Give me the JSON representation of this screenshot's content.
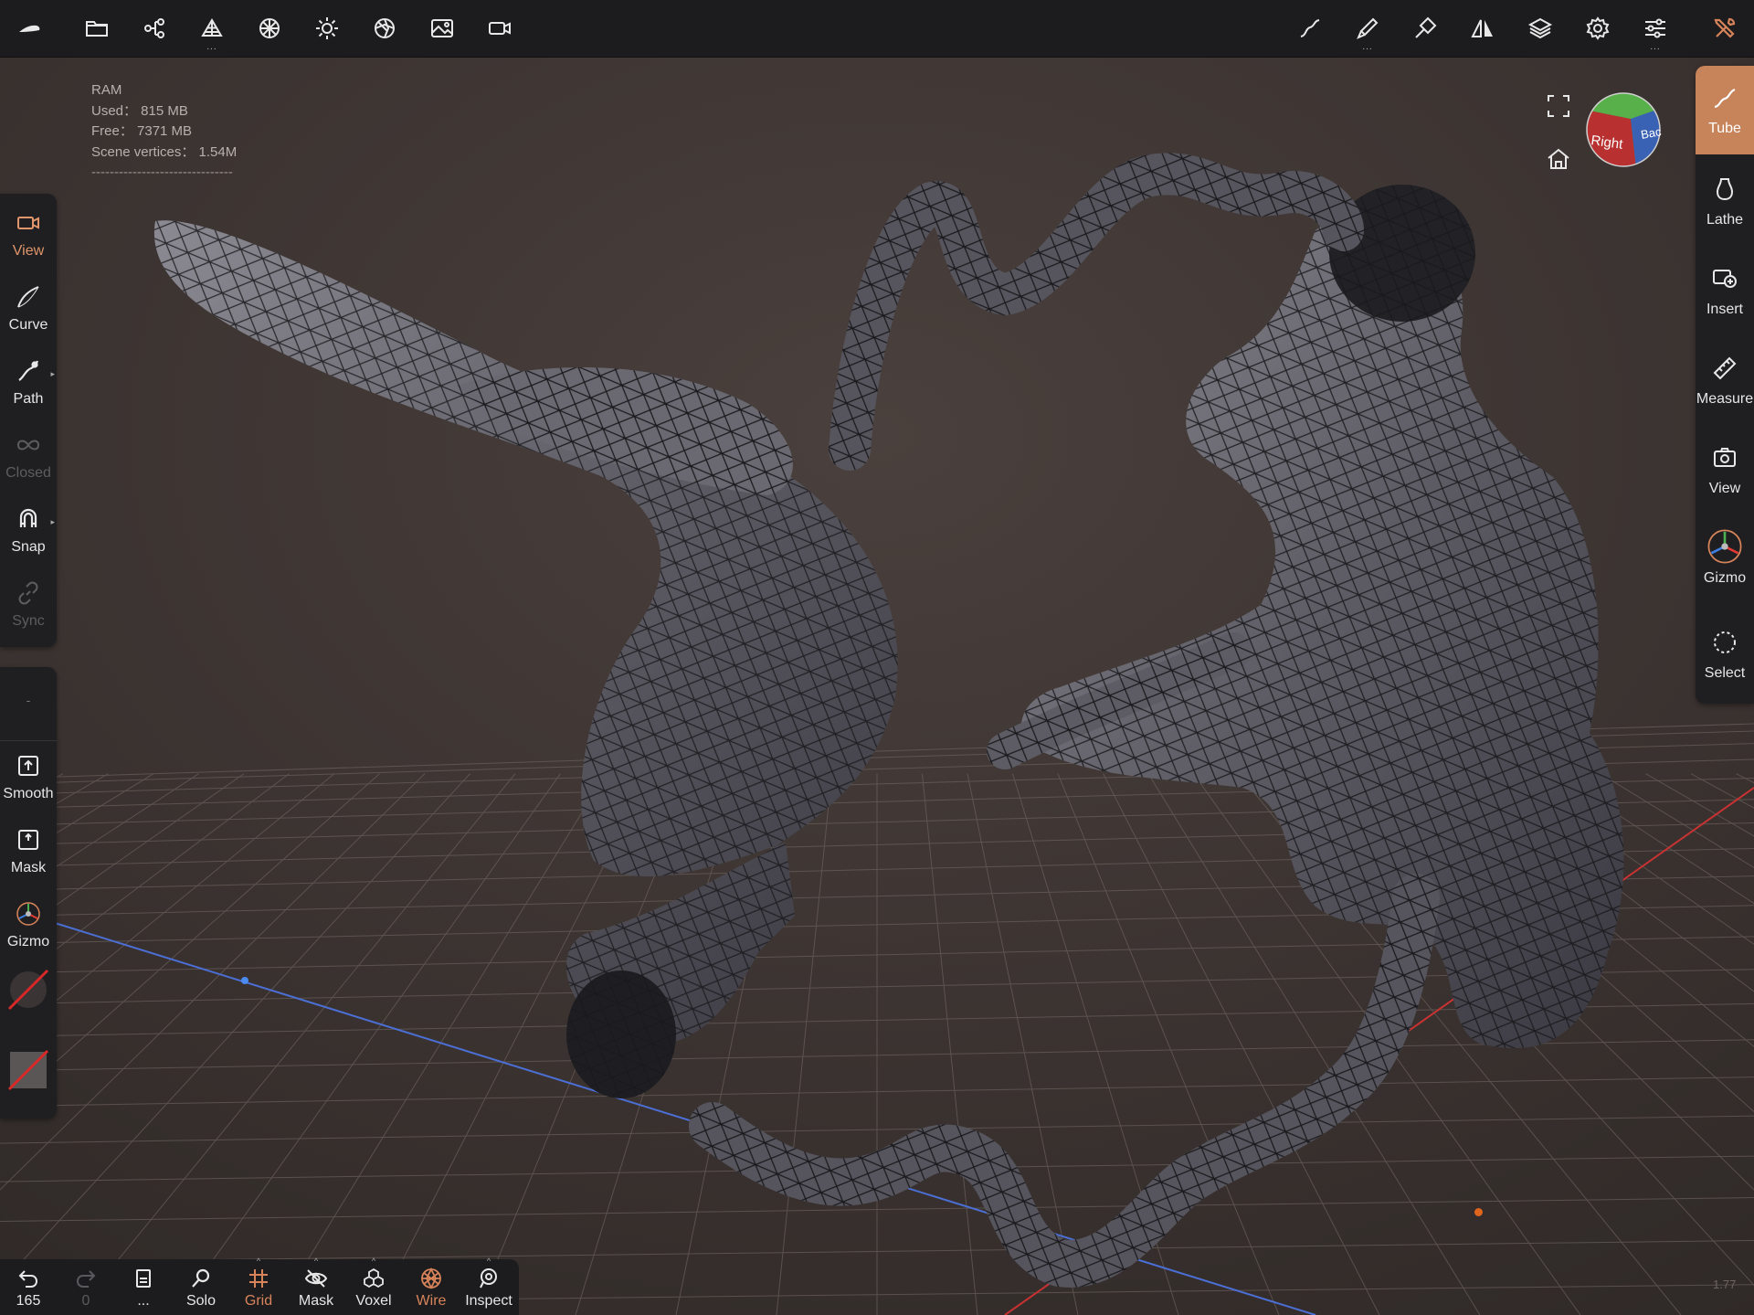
{
  "app": {
    "accent": "#d8845a",
    "active_panel_bg": "#c7835a"
  },
  "topbar": {
    "left_icons": [
      "app-logo-icon",
      "folder-icon",
      "scene-tree-icon",
      "topology-icon",
      "material-sphere-icon",
      "light-icon",
      "shading-icon",
      "background-image-icon",
      "camera-icon"
    ],
    "right_icons": [
      "stroke-icon",
      "brush-icon",
      "paint-icon",
      "symmetry-icon",
      "layers-icon",
      "settings-icon",
      "preferences-sliders-icon",
      "tools-icon"
    ]
  },
  "ram": {
    "title": "RAM",
    "used": "Used： 815 MB",
    "free": "Free： 7371 MB",
    "vertices": "Scene vertices： 1.54M",
    "separator": "-------------------------------"
  },
  "left_tools": [
    {
      "label": "View",
      "icon": "camera-icon",
      "state": "active"
    },
    {
      "label": "Curve",
      "icon": "curve-icon",
      "state": "normal"
    },
    {
      "label": "Path",
      "icon": "path-icon",
      "state": "normal"
    },
    {
      "label": "Closed",
      "icon": "infinity-icon",
      "state": "disabled"
    },
    {
      "label": "Snap",
      "icon": "magnet-icon",
      "state": "normal"
    },
    {
      "label": "Sync",
      "icon": "link-icon",
      "state": "disabled"
    }
  ],
  "left_tools2": [
    {
      "label": "Smooth",
      "icon": "smooth-icon"
    },
    {
      "label": "Mask",
      "icon": "mask-icon"
    },
    {
      "label": "Gizmo",
      "icon": "gizmo-icon"
    }
  ],
  "left_small": "-",
  "right_tools": [
    {
      "label": "Tube",
      "icon": "tube-icon"
    },
    {
      "label": "Lathe",
      "icon": "lathe-icon"
    },
    {
      "label": "Insert",
      "icon": "insert-icon"
    },
    {
      "label": "Measure",
      "icon": "ruler-icon"
    },
    {
      "label": "View",
      "icon": "camera-icon"
    },
    {
      "label": "Gizmo",
      "icon": "gizmo-icon"
    },
    {
      "label": "Select",
      "icon": "select-icon"
    }
  ],
  "viewcube": {
    "right": "Right",
    "back": "Bac"
  },
  "bottom": [
    {
      "label": "165",
      "icon": "undo-icon",
      "state": "normal"
    },
    {
      "label": "0",
      "icon": "redo-icon",
      "state": "dim"
    },
    {
      "label": "...",
      "icon": "history-icon",
      "state": "normal"
    },
    {
      "label": "Solo",
      "icon": "search-icon",
      "state": "normal"
    },
    {
      "label": "Grid",
      "icon": "grid-icon",
      "state": "active"
    },
    {
      "label": "Mask",
      "icon": "eye-off-icon",
      "state": "normal"
    },
    {
      "label": "Voxel",
      "icon": "voxel-icon",
      "state": "normal"
    },
    {
      "label": "Wire",
      "icon": "wireframe-icon",
      "state": "active"
    },
    {
      "label": "Inspect",
      "icon": "inspect-icon",
      "state": "normal"
    }
  ],
  "scale_label": "1.77"
}
